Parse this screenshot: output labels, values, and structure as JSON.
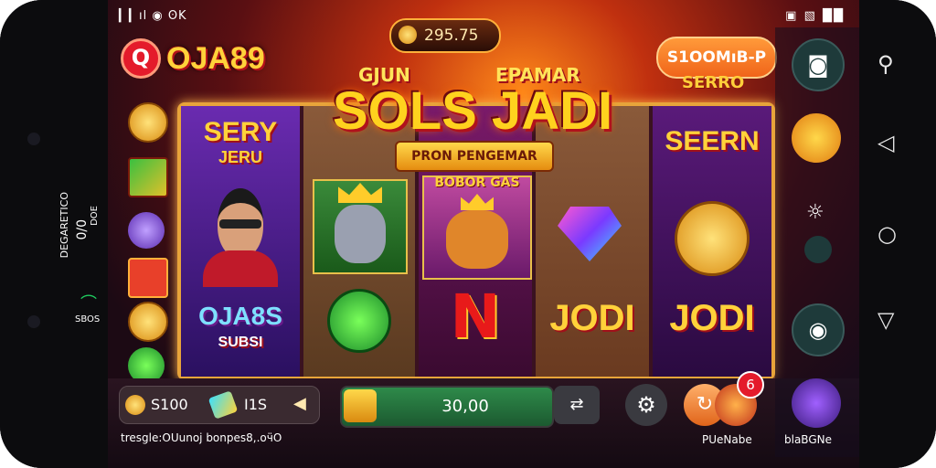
{
  "status_bar": {
    "left_text": "▎▎ıl ◉ ʘK",
    "right_text": "▣ ▧ ██"
  },
  "left_bezel": {
    "line1": "DEGARETICO",
    "line2": "0/0",
    "line3": "DOE",
    "line4": "SBOS"
  },
  "app": {
    "logo_letter": "Q",
    "brand": "OJA89"
  },
  "header": {
    "coin_value": "295.75",
    "promo_label": "S1OOMıB-P",
    "promo_sub": "SERRO"
  },
  "title": {
    "top_left": "GJUN",
    "top_right": "EPAMAR",
    "main": "SOLS JADI",
    "ribbon": "PRON PENGEMAR"
  },
  "reels": {
    "reel1": {
      "top": "SERY",
      "top2": "JERU",
      "bottom": "OJA8S",
      "bottom2": "SUBSI"
    },
    "reel3": {
      "banner": "BOBOR GAS"
    },
    "reel4": {
      "text": "JODI"
    },
    "reel5": {
      "top": "SEERN",
      "text": "JODI"
    }
  },
  "bottom": {
    "balance": "S100",
    "bet": "I1S",
    "spin_value": "30,00",
    "footer": "tresgle:OUunoј bonpes8,.oӵO",
    "notification_count": "6",
    "label_left": "PUeNabe",
    "label_right": "blaBGNe"
  },
  "colors": {
    "accent": "#ffd23a",
    "spin": "#2e8a4a",
    "promo": "#f0641a"
  }
}
